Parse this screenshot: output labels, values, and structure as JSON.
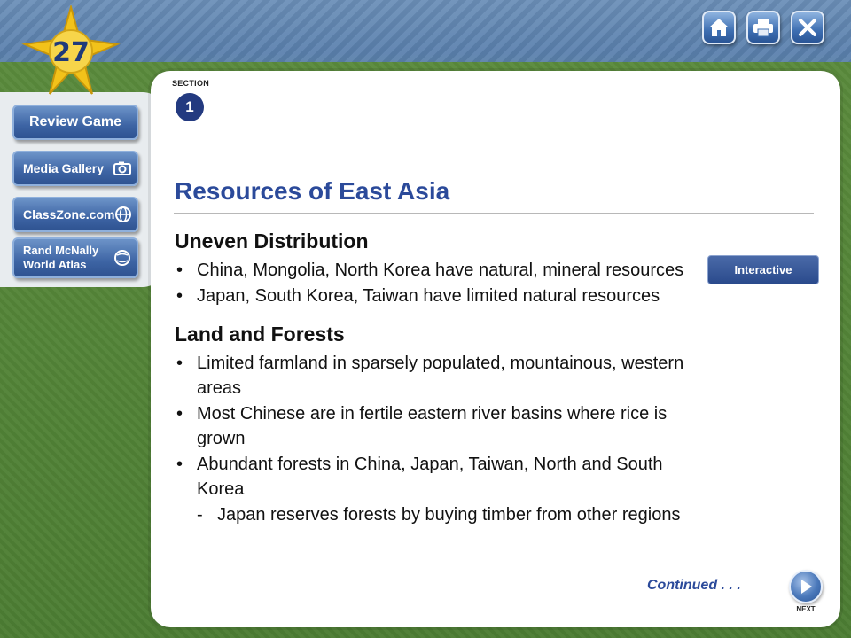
{
  "chapter": {
    "number": "27"
  },
  "nav": {
    "review_game": "Review Game",
    "media_gallery": "Media Gallery",
    "classzone": "ClassZone.com",
    "rand_mcnally": "Rand McNally World Atlas"
  },
  "toolbar": {
    "home_icon": "home-icon",
    "print_icon": "printer-icon",
    "close_icon": "close-icon"
  },
  "section": {
    "label": "SECTION",
    "number": "1"
  },
  "title": "Resources of East Asia",
  "sections": [
    {
      "heading": "Uneven Distribution",
      "bullets": [
        "China, Mongolia, North Korea have natural, mineral resources",
        "Japan, South Korea, Taiwan have limited natural resources"
      ]
    },
    {
      "heading": "Land and Forests",
      "bullets": [
        "Limited farmland in sparsely populated, mountainous, western areas",
        "Most Chinese are in fertile eastern river basins where rice is grown",
        "Abundant forests in China, Japan, Taiwan, North and South Korea"
      ],
      "sub_bullets": [
        "Japan reserves forests by buying timber from other regions"
      ]
    }
  ],
  "interactive_label": "Interactive",
  "continued_label": "Continued . . .",
  "next_label": "NEXT",
  "colors": {
    "title_blue": "#2b4a9a",
    "frame_green": "#4c7d33",
    "button_blue": "#3d64a4"
  }
}
